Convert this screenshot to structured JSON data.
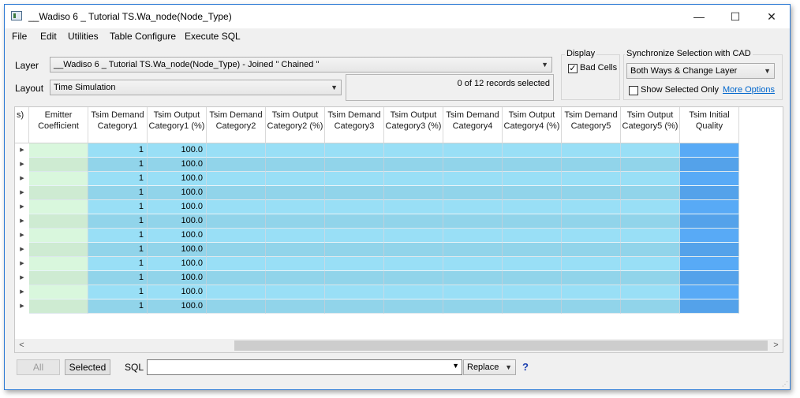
{
  "window": {
    "title": "__Wadiso 6 _ Tutorial TS.Wa_node(Node_Type)",
    "minimize": "—",
    "maximize": "☐",
    "close": "✕"
  },
  "menu": [
    "File",
    "Edit",
    "Utilities",
    "Table Configure",
    "Execute SQL"
  ],
  "layer": {
    "label": "Layer",
    "value": "__Wadiso 6 _ Tutorial TS.Wa_node(Node_Type) - Joined \" Chained \""
  },
  "layout": {
    "label": "Layout",
    "value": "Time Simulation"
  },
  "records_text": "0 of 12 records selected",
  "display": {
    "title": "Display",
    "bad_cells_label": "Bad Cells",
    "bad_cells_checked": "✓"
  },
  "sync": {
    "title": "Synchronize Selection with CAD",
    "value": "Both Ways & Change Layer",
    "show_selected_label": "Show Selected Only",
    "more_options": "More Options"
  },
  "table": {
    "partial_header": "s)",
    "columns": [
      {
        "label": "Emitter Coefficient",
        "color": "#d9f7dd"
      },
      {
        "label": "Tsim Demand Category1",
        "color": "#99dff6"
      },
      {
        "label": "Tsim Output Category1 (%)",
        "color": "#99dff6"
      },
      {
        "label": "Tsim Demand Category2",
        "color": "#99dff6"
      },
      {
        "label": "Tsim Output Category2 (%)",
        "color": "#99dff6"
      },
      {
        "label": "Tsim Demand Category3",
        "color": "#99dff6"
      },
      {
        "label": "Tsim Output Category3 (%)",
        "color": "#99dff6"
      },
      {
        "label": "Tsim Demand Category4",
        "color": "#99dff6"
      },
      {
        "label": "Tsim Output Category4 (%)",
        "color": "#99dff6"
      },
      {
        "label": "Tsim Demand Category5",
        "color": "#99dff6"
      },
      {
        "label": "Tsim Output Category5 (%)",
        "color": "#99dff6"
      },
      {
        "label": "Tsim Initial Quality",
        "color": "#58aaf6"
      }
    ],
    "rows": [
      [
        "",
        "1",
        "100.0",
        "",
        "",
        "",
        "",
        "",
        "",
        "",
        "",
        ""
      ],
      [
        "",
        "1",
        "100.0",
        "",
        "",
        "",
        "",
        "",
        "",
        "",
        "",
        ""
      ],
      [
        "",
        "1",
        "100.0",
        "",
        "",
        "",
        "",
        "",
        "",
        "",
        "",
        ""
      ],
      [
        "",
        "1",
        "100.0",
        "",
        "",
        "",
        "",
        "",
        "",
        "",
        "",
        ""
      ],
      [
        "",
        "1",
        "100.0",
        "",
        "",
        "",
        "",
        "",
        "",
        "",
        "",
        ""
      ],
      [
        "",
        "1",
        "100.0",
        "",
        "",
        "",
        "",
        "",
        "",
        "",
        "",
        ""
      ],
      [
        "",
        "1",
        "100.0",
        "",
        "",
        "",
        "",
        "",
        "",
        "",
        "",
        ""
      ],
      [
        "",
        "1",
        "100.0",
        "",
        "",
        "",
        "",
        "",
        "",
        "",
        "",
        ""
      ],
      [
        "",
        "1",
        "100.0",
        "",
        "",
        "",
        "",
        "",
        "",
        "",
        "",
        ""
      ],
      [
        "",
        "1",
        "100.0",
        "",
        "",
        "",
        "",
        "",
        "",
        "",
        "",
        ""
      ],
      [
        "",
        "1",
        "100.0",
        "",
        "",
        "",
        "",
        "",
        "",
        "",
        "",
        ""
      ],
      [
        "",
        "1",
        "100.0",
        "",
        "",
        "",
        "",
        "",
        "",
        "",
        "",
        ""
      ]
    ],
    "row_indicator": "▶",
    "scroll_left": "<",
    "scroll_right": ">"
  },
  "bottom": {
    "all_button": "All",
    "selected_button": "Selected",
    "sql_label": "SQL",
    "sql_value": "",
    "sql_dropdown_arrow": "⌵",
    "replace_value": "Replace",
    "help": "?"
  },
  "resize_grip": "⋰"
}
